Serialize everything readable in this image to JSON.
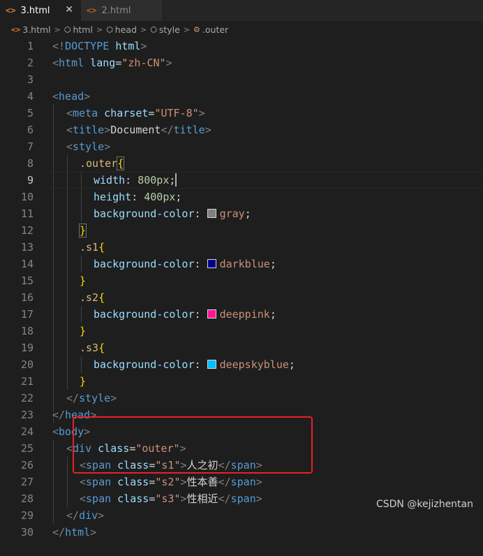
{
  "tabs": [
    {
      "icon": "<>",
      "label": "3.html",
      "close": "✕"
    },
    {
      "icon": "<>",
      "label": "2.html"
    }
  ],
  "breadcrumb": [
    {
      "icon": "<>",
      "label": "3.html"
    },
    {
      "icon": "⬡",
      "label": "html"
    },
    {
      "icon": "⬡",
      "label": "head"
    },
    {
      "icon": "⬡",
      "label": "style"
    },
    {
      "icon": "⚙",
      "label": ".outer"
    }
  ],
  "breadcrumb_separator": ">",
  "colors": {
    "gray": "#808080",
    "darkblue": "#00008b",
    "deeppink": "#ff1493",
    "deepskyblue": "#00bfff",
    "highlight_box": "#e8202a"
  },
  "lines": [
    {
      "num": "1",
      "t1": "<!",
      "t2": "DOCTYPE",
      "t3": " ",
      "t4": "html",
      "t5": ">"
    },
    {
      "num": "2",
      "t1": "<",
      "t2": "html",
      "t3": " lang",
      "t4": "=",
      "t5": "\"zh-CN\"",
      "t6": ">"
    },
    {
      "num": "3"
    },
    {
      "num": "4",
      "t1": "<",
      "t2": "head",
      "t3": ">"
    },
    {
      "num": "5",
      "t1": "<",
      "t2": "meta",
      "t3": " charset",
      "t4": "=",
      "t5": "\"UTF-8\"",
      "t6": ">"
    },
    {
      "num": "6",
      "t1": "<",
      "t2": "title",
      "t3": ">",
      "t4": "Document",
      "t5": "</",
      "t6": "title",
      "t7": ">"
    },
    {
      "num": "7",
      "t1": "<",
      "t2": "style",
      "t3": ">"
    },
    {
      "num": "8",
      "t1": ".outer",
      "t2": "{"
    },
    {
      "num": "9",
      "t1": "width",
      "t2": ": ",
      "t3": "800px",
      "t4": ";"
    },
    {
      "num": "10",
      "t1": "height",
      "t2": ": ",
      "t3": "400px",
      "t4": ";"
    },
    {
      "num": "11",
      "t1": "background-color",
      "t2": ": ",
      "t3": "gray",
      "t4": ";"
    },
    {
      "num": "12",
      "t1": "}"
    },
    {
      "num": "13",
      "t1": ".s1",
      "t2": "{"
    },
    {
      "num": "14",
      "t1": "background-color",
      "t2": ": ",
      "t3": "darkblue",
      "t4": ";"
    },
    {
      "num": "15",
      "t1": "}"
    },
    {
      "num": "16",
      "t1": ".s2",
      "t2": "{"
    },
    {
      "num": "17",
      "t1": "background-color",
      "t2": ": ",
      "t3": "deeppink",
      "t4": ";"
    },
    {
      "num": "18",
      "t1": "}"
    },
    {
      "num": "19",
      "t1": ".s3",
      "t2": "{"
    },
    {
      "num": "20",
      "t1": "background-color",
      "t2": ": ",
      "t3": "deepskyblue",
      "t4": ";"
    },
    {
      "num": "21",
      "t1": "}"
    },
    {
      "num": "22",
      "t1": "</",
      "t2": "style",
      "t3": ">"
    },
    {
      "num": "23",
      "t1": "</",
      "t2": "head",
      "t3": ">"
    },
    {
      "num": "24",
      "t1": "<",
      "t2": "body",
      "t3": ">"
    },
    {
      "num": "25",
      "t1": "<",
      "t2": "div",
      "t3": " class",
      "t4": "=",
      "t5": "\"outer\"",
      "t6": ">"
    },
    {
      "num": "26",
      "t1": "<",
      "t2": "span",
      "t3": " class",
      "t4": "=",
      "t5": "\"s1\"",
      "t6": ">",
      "t7": "人之初",
      "t8": "</",
      "t9": "span",
      "t10": ">"
    },
    {
      "num": "27",
      "t1": "<",
      "t2": "span",
      "t3": " class",
      "t4": "=",
      "t5": "\"s2\"",
      "t6": ">",
      "t7": "性本善",
      "t8": "</",
      "t9": "span",
      "t10": ">"
    },
    {
      "num": "28",
      "t1": "<",
      "t2": "span",
      "t3": " class",
      "t4": "=",
      "t5": "\"s3\"",
      "t6": ">",
      "t7": "性相近",
      "t8": "</",
      "t9": "span",
      "t10": ">"
    },
    {
      "num": "29",
      "t1": "</",
      "t2": "div",
      "t3": ">"
    },
    {
      "num": "30",
      "t1": "</",
      "t2": "html",
      "t3": ">"
    }
  ],
  "watermark": "CSDN @kejizhentan"
}
